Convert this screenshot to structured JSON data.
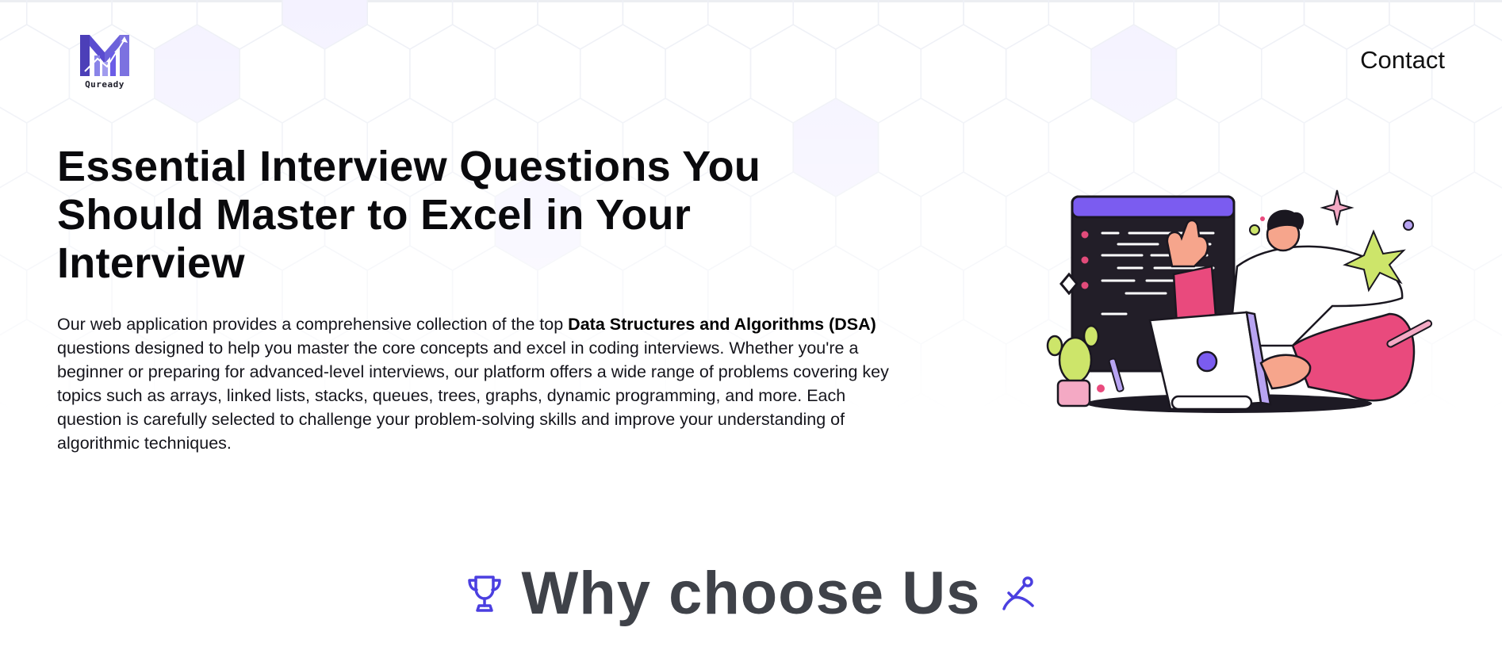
{
  "brand": {
    "name": "Quready",
    "logo_icon": "m-bars-logo",
    "accent": "#6b5ce7"
  },
  "nav": {
    "contact_label": "Contact"
  },
  "hero": {
    "title": "Essential Interview Questions You Should Master to Excel in Your Interview",
    "desc_intro": "Our web application provides a comprehensive collection of the top ",
    "desc_bold": "Data Structures and Algorithms (DSA)",
    "desc_rest": " questions designed to help you master the core concepts and excel in coding interviews. Whether you're a beginner or preparing for advanced-level interviews, our platform offers a wide range of problems covering key topics such as arrays, linked lists, stacks, queues, trees, graphs, dynamic programming, and more. Each question is carefully selected to challenge your problem-solving skills and improve your understanding of algorithmic techniques.",
    "illustration": "developer-at-laptop-illustration"
  },
  "why": {
    "title": "Why choose Us",
    "left_icon": "trophy-icon",
    "right_icon": "graph-nodes-icon",
    "icon_color": "#4b3fe0"
  },
  "colors": {
    "background": "#ffffff",
    "hex_grid": "#eef0f6",
    "title_text": "#0a0a0d",
    "section_title": "#3f4249"
  }
}
